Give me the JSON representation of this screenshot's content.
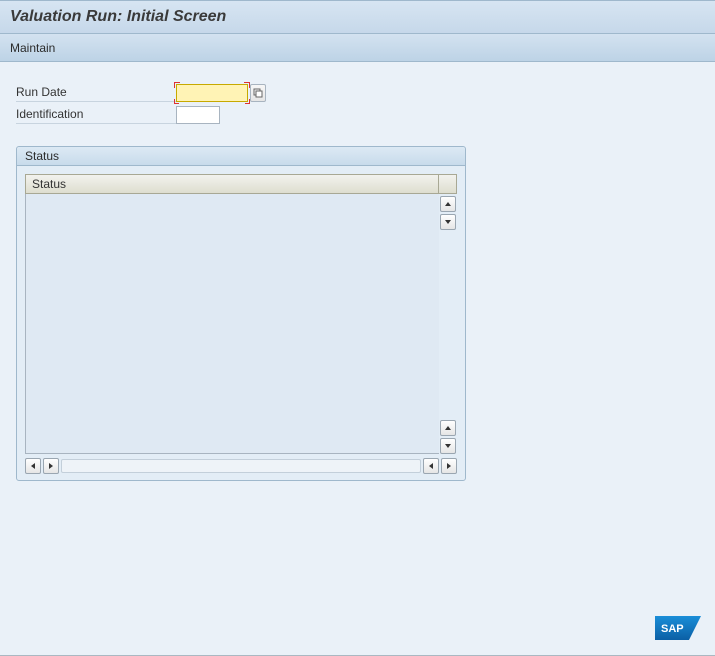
{
  "title": "Valuation Run: Initial Screen",
  "toolbar": {
    "maintain_label": "Maintain"
  },
  "form": {
    "run_date_label": "Run Date",
    "run_date_value": "",
    "identification_label": "Identification",
    "identification_value": ""
  },
  "status_group": {
    "title": "Status",
    "column_header": "Status"
  },
  "logo_text": "SAP"
}
